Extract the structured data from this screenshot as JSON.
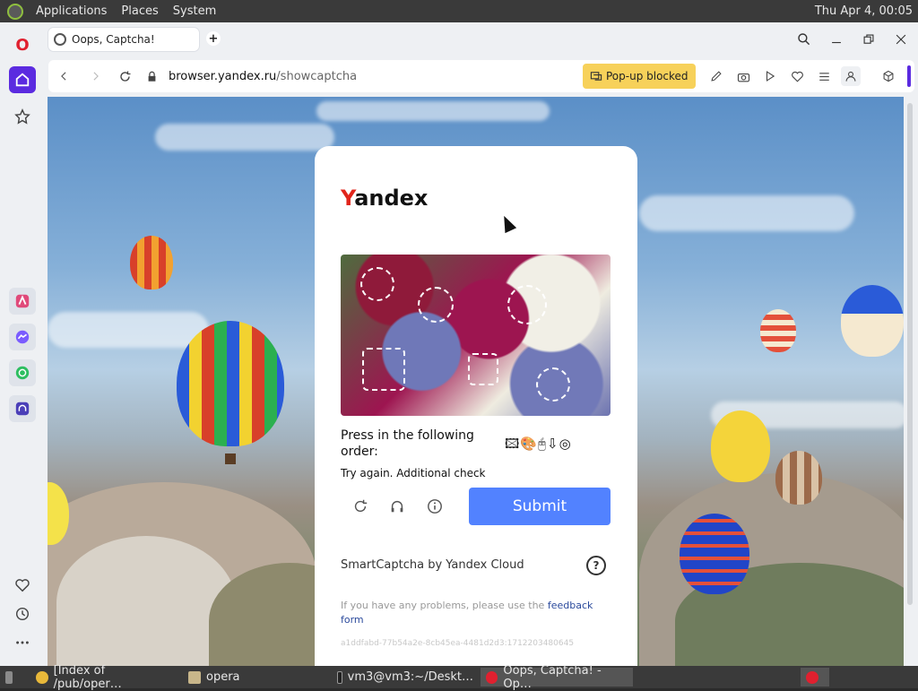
{
  "top_panel": {
    "menus": [
      "Applications",
      "Places",
      "System"
    ],
    "clock": "Thu Apr  4, 00:05"
  },
  "tab": {
    "title": "Oops, Captcha!",
    "new_tab_label": "+"
  },
  "address_bar": {
    "url_domain": "browser.yandex.ru",
    "url_path": "/showcaptcha",
    "popup_blocked": "Pop-up blocked"
  },
  "captcha": {
    "logo_y": "Y",
    "logo_rest": "andex",
    "instruction": "Press in the following order:",
    "sequence": "🖾🎨🖰⇩◎",
    "retry_text": "Try again. Additional check",
    "submit_label": "Submit",
    "provider": "SmartCaptcha by Yandex Cloud",
    "help_icon": "?",
    "problems_text": "If you have any problems, please use the",
    "feedback_link": "feedback form",
    "hash": "a1ddfabd-77b54a2e-8cb45ea-4481d2d3:1712203480645"
  },
  "taskbar": {
    "items": [
      "[Index of /pub/oper…",
      "opera",
      "vm3@vm3:~/Deskt…",
      "Oops, Captcha! - Op…"
    ]
  },
  "colors": {
    "accent_sidebar": "#5b2be0",
    "submit": "#5282ff",
    "yandex_red": "#e1251b",
    "popup_yellow": "#f7d15a"
  }
}
